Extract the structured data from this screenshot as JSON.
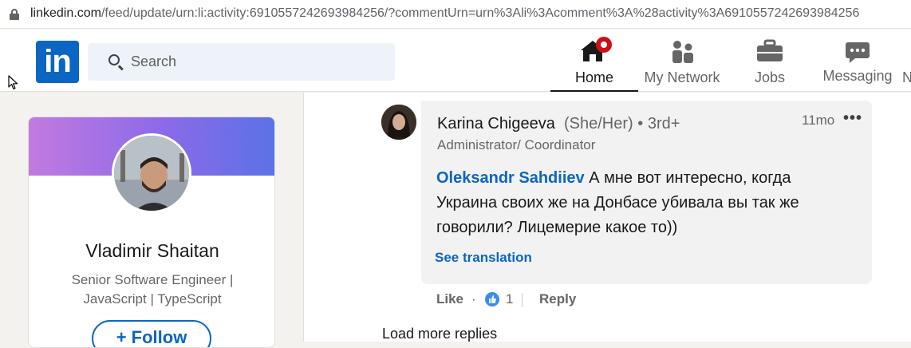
{
  "browser": {
    "url_host": "linkedin.com",
    "url_path": "/feed/update/urn:li:activity:6910557242693984256/?commentUrn=urn%3Ali%3Acomment%3A%28activity%3A6910557242693984256"
  },
  "navbar": {
    "logo": "in",
    "search_placeholder": "Search",
    "items": [
      {
        "label": "Home",
        "icon": "home-icon",
        "active": true
      },
      {
        "label": "My Network",
        "icon": "network-icon"
      },
      {
        "label": "Jobs",
        "icon": "briefcase-icon"
      },
      {
        "label": "Messaging",
        "icon": "messaging-icon"
      },
      {
        "label": "N",
        "icon": "notifications-icon"
      }
    ]
  },
  "profile_card": {
    "name": "Vladimir Shaitan",
    "headline": "Senior Software Engineer | JavaScript | TypeScript",
    "follow_label": "+ Follow"
  },
  "comment": {
    "author": "Karina Chigeeva",
    "pronouns": "(She/Her)",
    "degree": "• 3rd+",
    "headline": "Administrator/ Coordinator",
    "time": "11mo",
    "more": "•••",
    "mention": "Oleksandr Sahdiiev",
    "text": " А мне вот интересно, когда Украина своих же на Донбасе убивала вы так же говорили? Лицемерие какое то))",
    "see_translation": "See translation",
    "like_label": "Like",
    "dot": "·",
    "reaction_count": "1",
    "reply_label": "Reply"
  },
  "load_more": "Load more replies",
  "colors": {
    "brand": "#0a66c2",
    "notification_badge": "#cc1016"
  }
}
